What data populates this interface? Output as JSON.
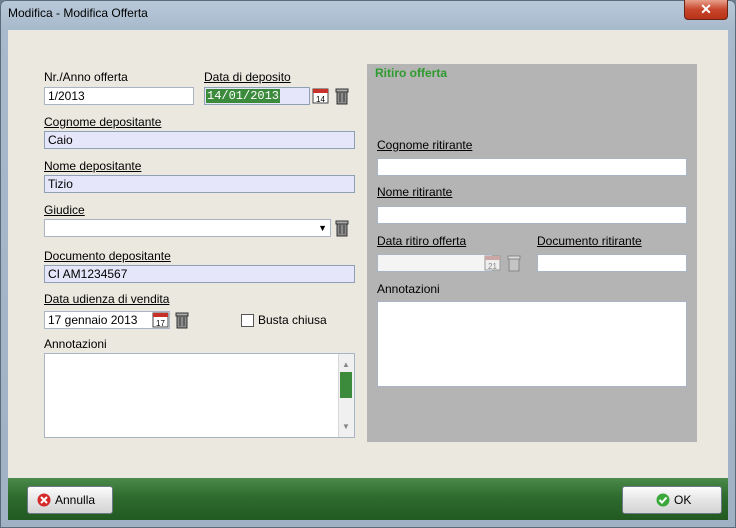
{
  "window": {
    "title": "Modifica - Modifica Offerta",
    "close_glyph": "✕"
  },
  "form": {
    "offer_number_label": "Nr./Anno offerta",
    "offer_number_value": "1/2013",
    "deposit_date_label": "Data di deposito",
    "deposit_date_value": "14/01/2013",
    "depositor_surname_label": "Cognome depositante",
    "depositor_surname_value": "Caio",
    "depositor_name_label": "Nome depositante",
    "depositor_name_value": "Tizio",
    "judge_label": "Giudice",
    "judge_value": "",
    "depositor_document_label": "Documento depositante",
    "depositor_document_value": "CI AM1234567",
    "hearing_date_label": "Data udienza di vendita",
    "hearing_date_value": "17 gennaio 2013",
    "calendar_day_deposit": "14",
    "calendar_day_hearing": "17",
    "sealed_envelope_label": "Busta chiusa",
    "sealed_envelope_checked": false,
    "notes_label": "Annotazioni"
  },
  "withdrawal": {
    "title": "Ritiro offerta",
    "surname_label": "Cognome ritirante",
    "name_label": "Nome ritirante",
    "date_label": "Data ritiro offerta",
    "document_label": "Documento ritirante",
    "calendar_day": "21",
    "notes_label": "Annotazioni"
  },
  "footer": {
    "cancel_label": "Annulla",
    "ok_label": "OK"
  },
  "colors": {
    "panel_title": "#2e9b2e",
    "footer": "#2e6b2e",
    "required_field": "#e6e6fa"
  }
}
